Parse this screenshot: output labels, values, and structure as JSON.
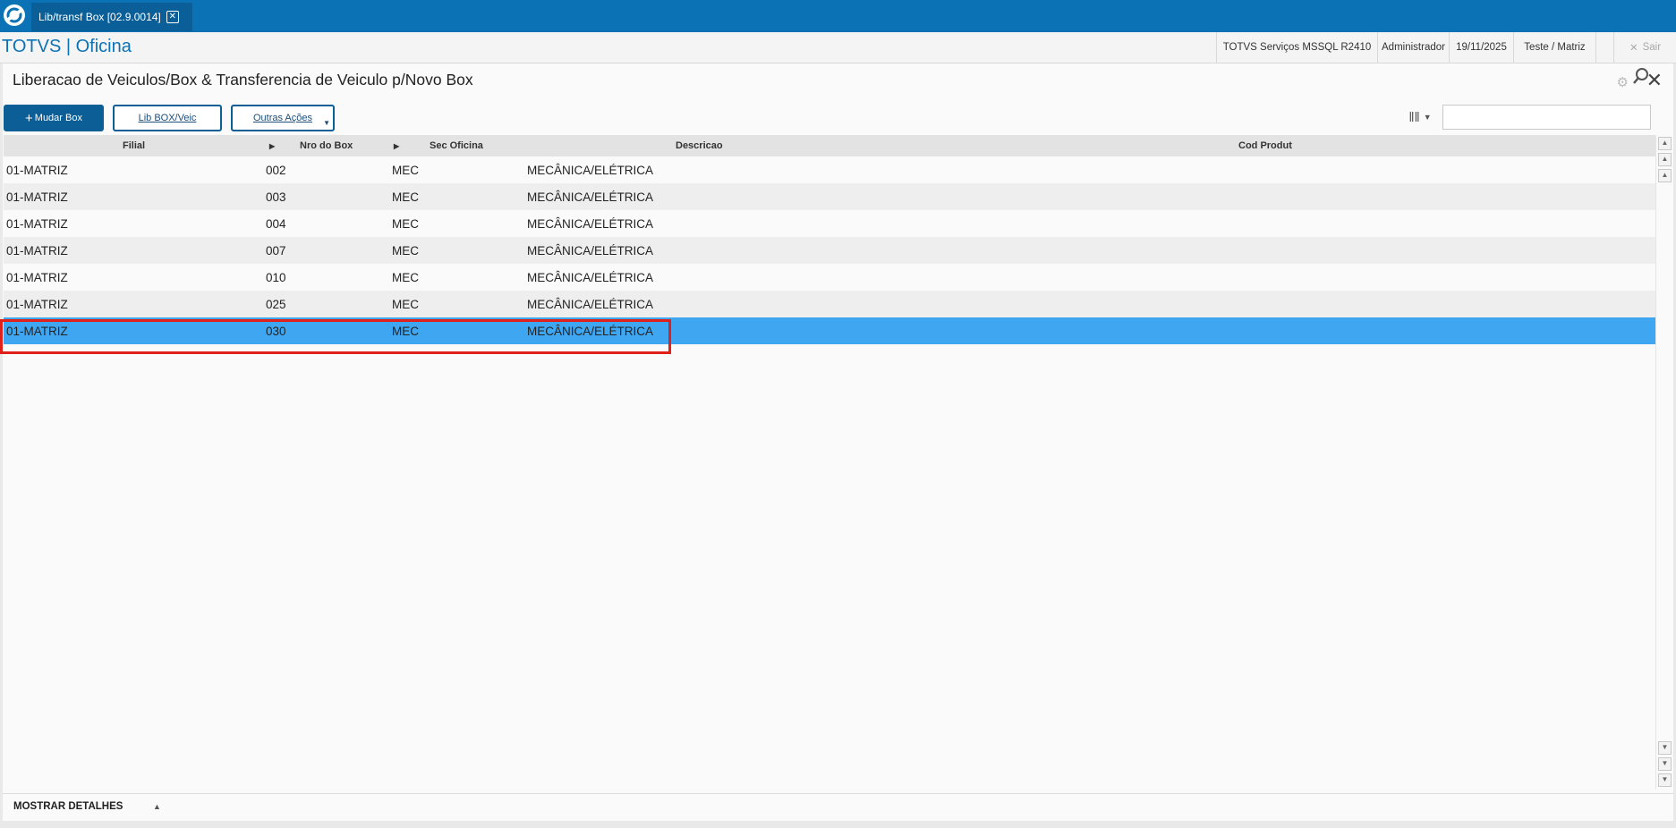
{
  "tabbar": {
    "tab_label": "Lib/transf Box [02.9.0014]"
  },
  "header": {
    "brand": "TOTVS | Oficina",
    "environment": "TOTVS Serviços MSSQL R2410",
    "user": "Administrador",
    "date": "19/11/2025",
    "company": "Teste / Matriz",
    "exit_label": "Sair"
  },
  "page": {
    "title": "Liberacao de Veiculos/Box & Transferencia de Veiculo p/Novo Box"
  },
  "toolbar": {
    "mudar_box_label": "Mudar Box",
    "lib_box_label": "Lib BOX/Veic",
    "outras_acoes_label": "Outras Ações",
    "search_value": ""
  },
  "grid": {
    "columns": [
      "Filial",
      "Nro do Box",
      "Sec Oficina",
      "Descricao",
      "Cod Produt"
    ],
    "rows": [
      {
        "filial": "01-MATRIZ",
        "box": "002",
        "sec": "MEC",
        "descricao": "MECÂNICA/ELÉTRICA",
        "cod": ""
      },
      {
        "filial": "01-MATRIZ",
        "box": "003",
        "sec": "MEC",
        "descricao": "MECÂNICA/ELÉTRICA",
        "cod": ""
      },
      {
        "filial": "01-MATRIZ",
        "box": "004",
        "sec": "MEC",
        "descricao": "MECÂNICA/ELÉTRICA",
        "cod": ""
      },
      {
        "filial": "01-MATRIZ",
        "box": "007",
        "sec": "MEC",
        "descricao": "MECÂNICA/ELÉTRICA",
        "cod": ""
      },
      {
        "filial": "01-MATRIZ",
        "box": "010",
        "sec": "MEC",
        "descricao": "MECÂNICA/ELÉTRICA",
        "cod": ""
      },
      {
        "filial": "01-MATRIZ",
        "box": "025",
        "sec": "MEC",
        "descricao": "MECÂNICA/ELÉTRICA",
        "cod": ""
      },
      {
        "filial": "01-MATRIZ",
        "box": "030",
        "sec": "MEC",
        "descricao": "MECÂNICA/ELÉTRICA",
        "cod": ""
      }
    ],
    "selected_row": 6
  },
  "footer": {
    "details_label": "MOSTRAR DETALHES"
  },
  "colors": {
    "brand_blue": "#0b72b5",
    "button_blue": "#0b5e96",
    "selected_row": "#3fa7f2",
    "highlight_border": "#e0201b"
  }
}
